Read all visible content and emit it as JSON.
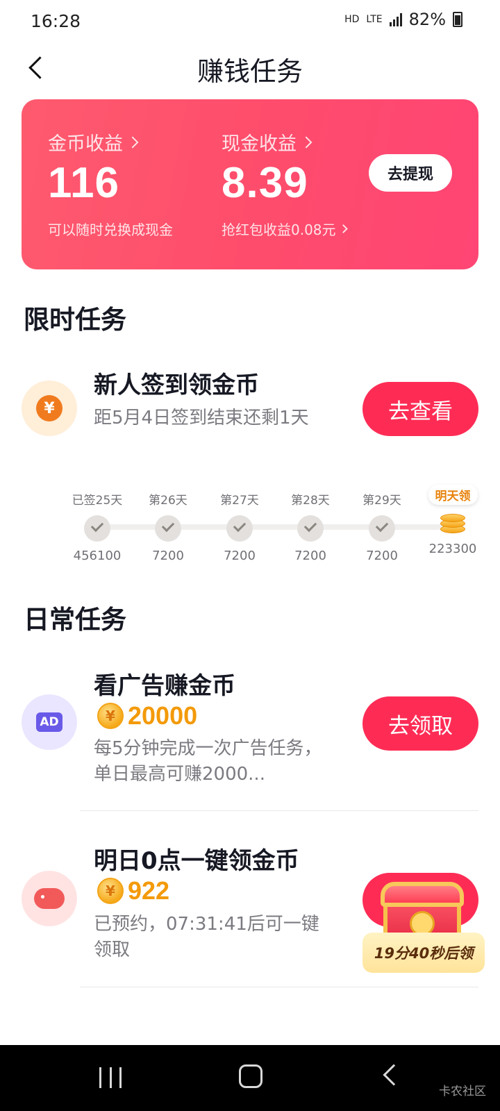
{
  "status_bar": {
    "time": "16:28",
    "hd": "HD",
    "network": "LTE",
    "battery": "82%"
  },
  "nav": {
    "title": "赚钱任务"
  },
  "earnings": {
    "coin": {
      "label": "金币收益",
      "value": "116",
      "sub": "可以随时兑换成现金"
    },
    "cash": {
      "label": "现金收益",
      "value": "8.39",
      "sub": "抢红包收益0.08元"
    },
    "withdraw_label": "去提现"
  },
  "limited": {
    "section_title": "限时任务",
    "task": {
      "title": "新人签到领金币",
      "desc": "距5月4日签到结束还剩1天",
      "button": "去查看",
      "icon_glyph": "¥"
    },
    "progress": [
      {
        "label": "已签25天",
        "amount": "456100",
        "state": "done"
      },
      {
        "label": "第26天",
        "amount": "7200",
        "state": "done"
      },
      {
        "label": "第27天",
        "amount": "7200",
        "state": "done"
      },
      {
        "label": "第28天",
        "amount": "7200",
        "state": "done"
      },
      {
        "label": "第29天",
        "amount": "7200",
        "state": "done"
      },
      {
        "label": "明天领",
        "amount": "223300",
        "state": "tomorrow"
      }
    ]
  },
  "daily": {
    "section_title": "日常任务",
    "tasks": [
      {
        "title": "看广告赚金币",
        "coins": "20000",
        "desc": "每5分钟完成一次广告任务，单日最高可赚2000...",
        "button": "去领取",
        "icon_text": "AD"
      },
      {
        "title": "明日0点一键领金币",
        "coins": "922",
        "desc": "已预约，07:31:41后可一键领取",
        "timer": "19分40秒后领"
      }
    ]
  },
  "coin_glyph": "¥",
  "watermark": "卡农社区",
  "colors": {
    "primary": "#fe2c55",
    "card": "#fe5370",
    "coin": "#f39a0a"
  }
}
